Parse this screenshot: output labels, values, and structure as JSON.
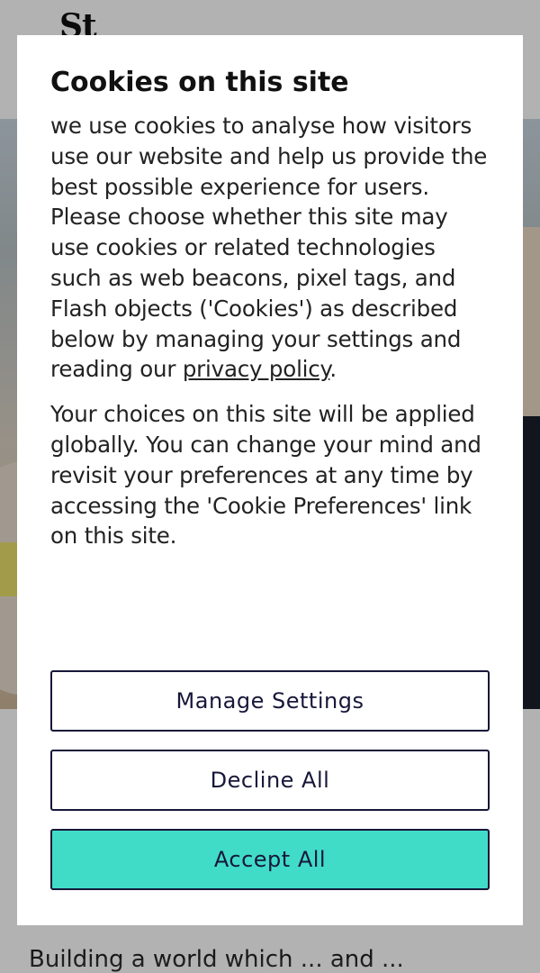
{
  "site": {
    "logo_text": "St",
    "below_text": "Building a world which ... and ..."
  },
  "modal": {
    "title": "Cookies on this site",
    "para1_before_link": "we use cookies to analyse how visitors use our website and help us provide the best possible experience for users. Please choose whether this site may use cookies or related technologies such as web beacons, pixel tags, and Flash objects ('Cookies') as described below by managing your settings and reading our ",
    "privacy_link_text": "privacy policy",
    "para1_after_link": ".",
    "para2": "Your choices on this site will be applied globally. You can change your mind and revisit your preferences at any time by accessing the 'Cookie Preferences' link on this site.",
    "buttons": {
      "manage": "Manage Settings",
      "decline": "Decline All",
      "accept": "Accept All"
    }
  },
  "colors": {
    "accent": "#40dcc8",
    "button_text": "#17173a",
    "overlay": "rgba(0,0,0,0.30)"
  }
}
